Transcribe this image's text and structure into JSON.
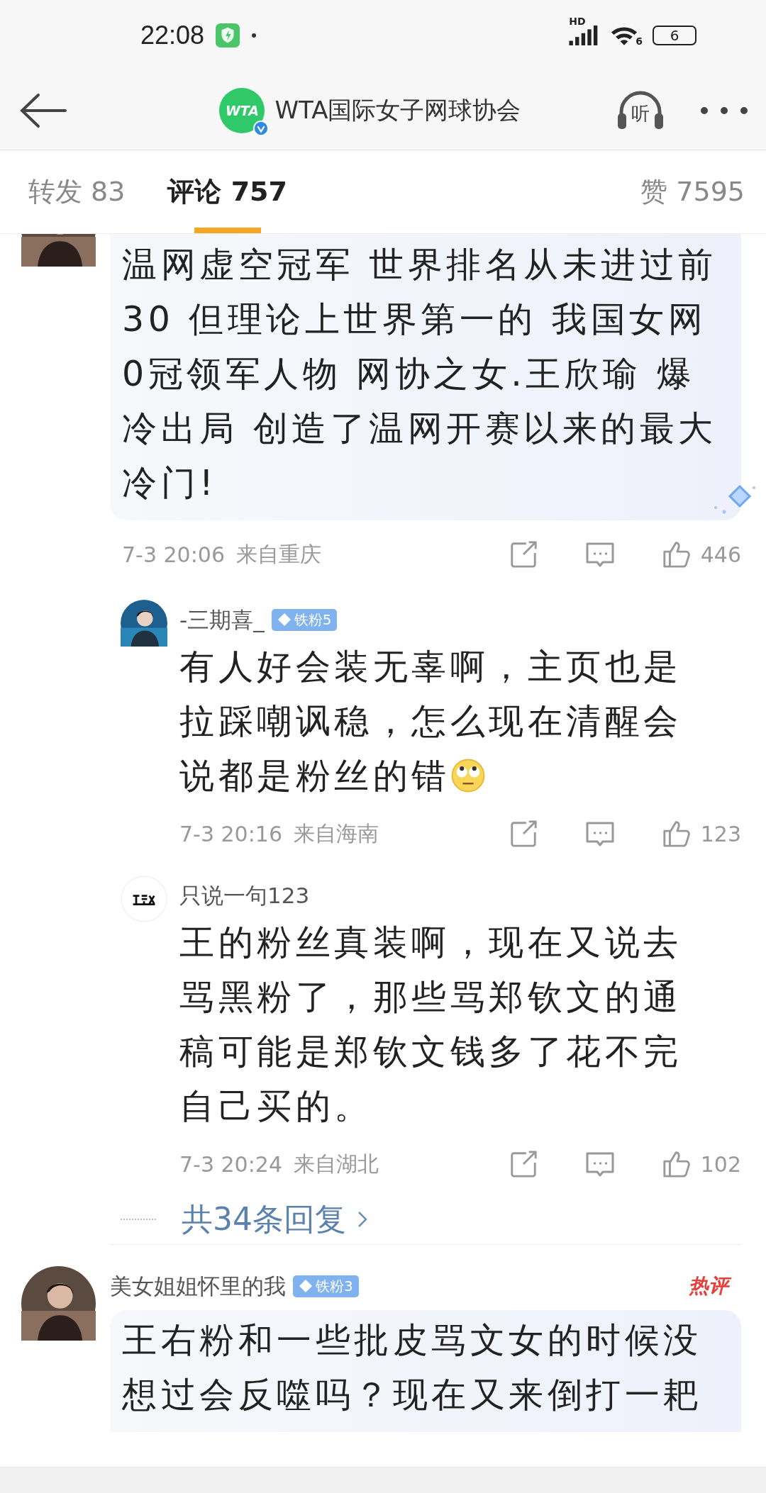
{
  "status_bar": {
    "time": "22:08",
    "network": "HD",
    "wifi_badge": "6",
    "battery": "6"
  },
  "header": {
    "logo_text": "WTA",
    "title": "WTA国际女子网球协会",
    "listen_label": "听"
  },
  "tabs": [
    {
      "label": "转发 83",
      "selected": false
    },
    {
      "label": "评论 757",
      "selected": true
    },
    {
      "label": "赞 7595",
      "selected": false
    }
  ],
  "comments": [
    {
      "text": "温网虚空冠军 世界排名从未进过前30 但理论上世界第一的 我国女网0冠领军人物 网协之女.王欣瑜 爆冷出局 创造了温网开赛以来的最大冷门!",
      "hot": false,
      "time": "7-3 20:06",
      "location": "来自重庆",
      "likes": "446",
      "replies": [
        {
          "name": "-三期喜_",
          "badge": "铁粉5",
          "text": "有人好会装无辜啊，主页也是拉踩嘲讽稳，怎么现在清醒会说都是粉丝的错",
          "emoji": true,
          "time": "7-3 20:16",
          "location": "来自海南",
          "likes": "123"
        },
        {
          "kind": "logo",
          "name": "只说一句123",
          "text": "王的粉丝真装啊，现在又说去骂黑粉了，那些骂郑钦文的通稿可能是郑钦文钱多了花不完自己买的。",
          "emoji": false,
          "time": "7-3 20:24",
          "location": "来自湖北",
          "likes": "102"
        }
      ],
      "more_replies": "共34条回复"
    },
    {
      "name": "美女姐姐怀里的我",
      "badge": "铁粉3",
      "hot": true,
      "hot_label": "热评",
      "text": "王右粉和一些批皮骂文女的时候没想过会反噬吗？现在又来倒打一耙"
    }
  ]
}
